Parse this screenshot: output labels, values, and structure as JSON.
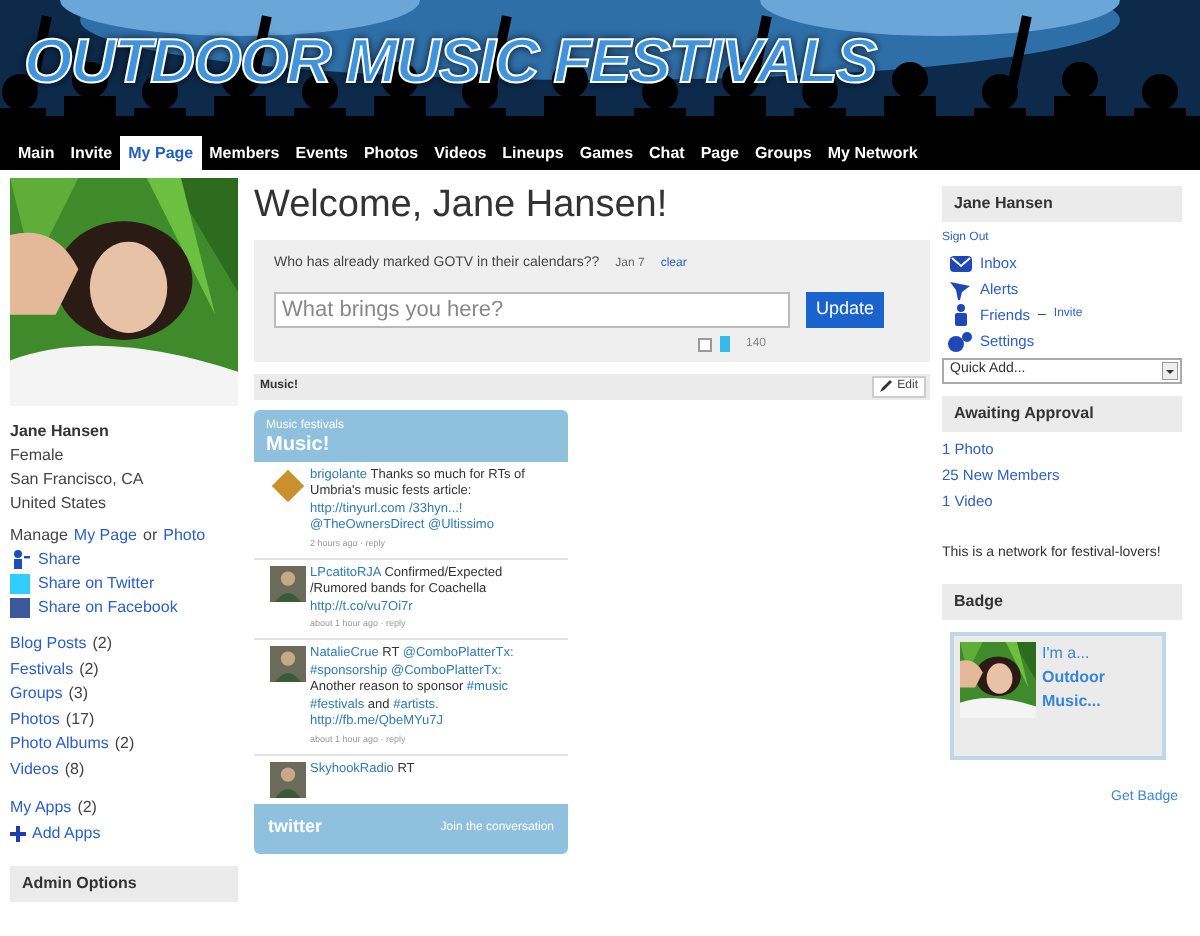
{
  "header": {
    "title": "OUTDOOR MUSIC FESTIVALS"
  },
  "nav": [
    {
      "label": "Main",
      "selected": false
    },
    {
      "label": "Invite",
      "selected": false
    },
    {
      "label": "My Page",
      "selected": true
    },
    {
      "label": "Members",
      "selected": false
    },
    {
      "label": "Events",
      "selected": false
    },
    {
      "label": "Photos",
      "selected": false
    },
    {
      "label": "Videos",
      "selected": false
    },
    {
      "label": "Lineups",
      "selected": false
    },
    {
      "label": "Games",
      "selected": false
    },
    {
      "label": "Chat",
      "selected": false
    },
    {
      "label": "Page",
      "selected": false
    },
    {
      "label": "Groups",
      "selected": false
    },
    {
      "label": "My Network",
      "selected": false
    }
  ],
  "profile": {
    "name": "Jane Hansen",
    "details": [
      "Female",
      "San Francisco, CA",
      "United States"
    ],
    "manage": {
      "prefix": "Manage",
      "page_link": "My Page",
      "middle": "or",
      "photo_link": "Photo"
    },
    "share": [
      {
        "kind": "share",
        "label": "Share"
      },
      {
        "kind": "twitter",
        "label": "Share on Twitter"
      },
      {
        "kind": "facebook",
        "label": "Share on Facebook"
      }
    ],
    "content_links": [
      {
        "label": "Blog Posts",
        "count": "(2)"
      },
      {
        "label": "Festivals",
        "count": "(2)"
      },
      {
        "label": "Groups",
        "count": "(3)"
      },
      {
        "label": "Photos",
        "count": "(17)"
      },
      {
        "label": "Photo Albums",
        "count": "(2)"
      },
      {
        "label": "Videos",
        "count": "(8)"
      }
    ],
    "apps": {
      "label": "My Apps",
      "count": "(2)"
    },
    "add_apps": "Add Apps",
    "admin_header": "Admin Options"
  },
  "welcome": "Welcome, Jane Hansen!",
  "status": {
    "text": "Who has already marked GOTV in their calendars??",
    "date": "Jan 7",
    "clear": "clear",
    "placeholder": "What brings you here?",
    "button": "Update",
    "tweet_checked": false,
    "count": "140"
  },
  "music_section": {
    "title": "Music!",
    "edit": "Edit"
  },
  "twitter_widget": {
    "subtitle": "Music festivals",
    "title": "Music!",
    "brand": "twitter",
    "footer": "Join the conversation",
    "tweets": [
      {
        "user": "brigolante",
        "parts": [
          {
            "text": "Thanks so much for RTs of Umbria's music fests article:",
            "link": false
          },
          {
            "text": "http://tinyurl.com",
            "link": true
          },
          {
            "text": "/33hyn...!",
            "link": true
          },
          {
            "text": "@TheOwnersDirect",
            "link": true
          },
          {
            "text": "@Ultissimo",
            "link": true
          }
        ],
        "meta": "2 hours ago · reply"
      },
      {
        "user": "LPcatitoRJA",
        "parts": [
          {
            "text": "Confirmed/Expected /Rumored bands for Coachella",
            "link": false
          },
          {
            "text": "http://t.co/vu7Oi7r",
            "link": true
          }
        ],
        "meta": "about 1 hour ago · reply"
      },
      {
        "user": "NatalieCrue",
        "parts": [
          {
            "text": "RT",
            "link": false
          },
          {
            "text": "@ComboPlatterTx:",
            "link": true
          },
          {
            "text": "#sponsorship",
            "link": true
          },
          {
            "text": "@ComboPlatterTx:",
            "link": true
          },
          {
            "text": "Another reason to sponsor",
            "link": false
          },
          {
            "text": "#music",
            "link": true
          },
          {
            "text": "#festivals",
            "link": true
          },
          {
            "text": "and",
            "link": false
          },
          {
            "text": "#artists.",
            "link": true
          },
          {
            "text": "http://fb.me/QbeMYu7J",
            "link": true
          }
        ],
        "meta": "about 1 hour ago · reply"
      },
      {
        "user": "SkyhookRadio",
        "parts": [
          {
            "text": "RT",
            "link": false
          }
        ]
      }
    ]
  },
  "account": {
    "name": "Jane Hansen",
    "sign_out": "Sign Out",
    "links": [
      {
        "kind": "inbox",
        "label": "Inbox"
      },
      {
        "kind": "alerts",
        "label": "Alerts"
      },
      {
        "kind": "friends",
        "label": "Friends",
        "separator": "–",
        "extra": "Invite"
      },
      {
        "kind": "settings",
        "label": "Settings"
      }
    ],
    "quick_add": "Quick Add..."
  },
  "approval": {
    "header": "Awaiting Approval",
    "items": [
      "1 Photo",
      "25 New Members",
      "1 Video"
    ]
  },
  "about": "This is a network for festival-lovers!",
  "badge": {
    "header": "Badge",
    "line1": "I'm a...",
    "line2": "Outdoor",
    "line3": "Music...",
    "link": "Get Badge"
  }
}
